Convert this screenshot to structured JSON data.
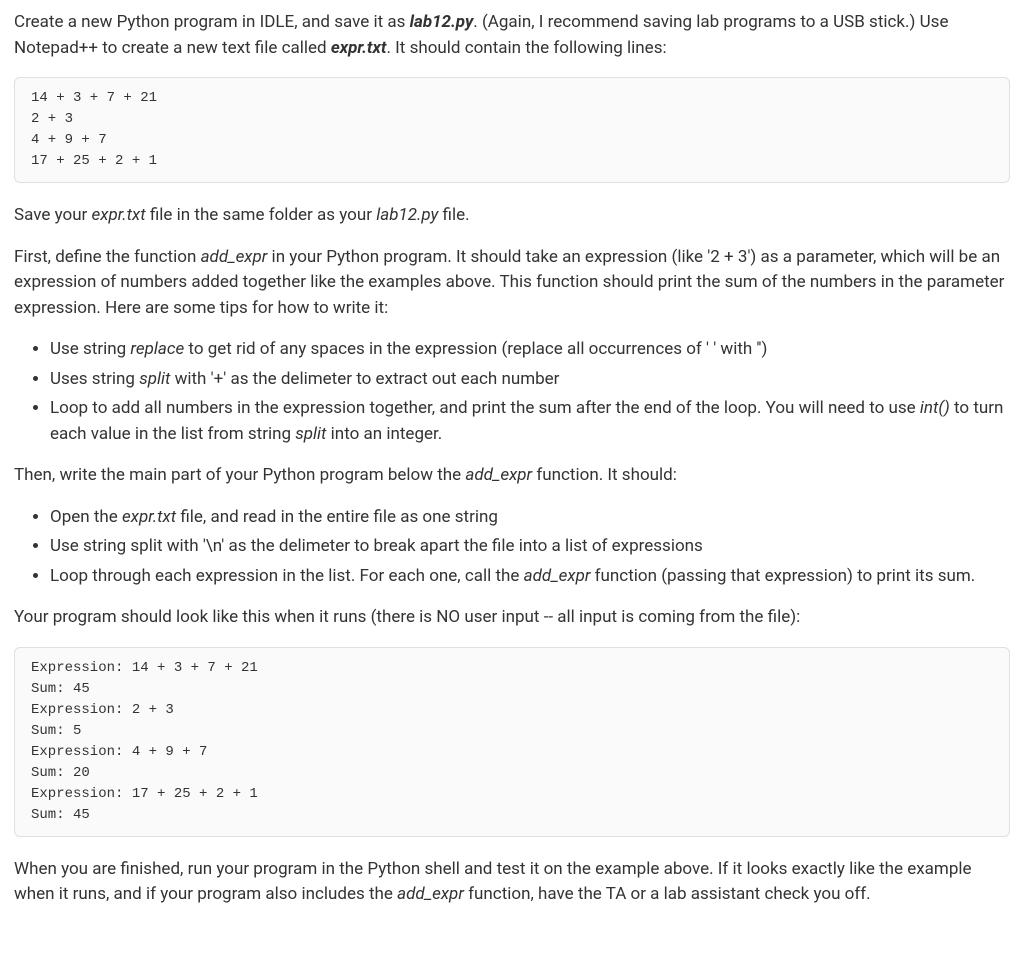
{
  "intro": {
    "part1": "Create a new Python program in IDLE, and save it as ",
    "lab12": "lab12.py",
    "part2": ". (Again, I recommend saving lab programs to a USB stick.) Use Notepad++ to create a new text file called ",
    "exprtxt": "expr.txt",
    "part3": ". It should contain the following lines:"
  },
  "code1": "14 + 3 + 7 + 21\n2 + 3\n4 + 9 + 7\n17 + 25 + 2 + 1",
  "savepara": {
    "part1": "Save your ",
    "exprfile": "expr.txt",
    "part2": " file in the same folder as your ",
    "lab12file": "lab12.py",
    "part3": " file."
  },
  "firstpara": {
    "part1": "First, define the function ",
    "addexpr": "add_expr",
    "part2": " in your Python program. It should take an expression (like '2 + 3') as a parameter, which will be an expression of numbers added together like the examples above. This function should print the sum of the numbers in the parameter expression. Here are some tips for how to write it:"
  },
  "list1": {
    "item1_a": "Use string ",
    "item1_replace": "replace",
    "item1_b": " to get rid of any spaces in the expression (replace all occurrences of ' ' with '')",
    "item2_a": "Uses string ",
    "item2_split": "split",
    "item2_b": " with '+' as the delimeter to extract out each number",
    "item3_a": "Loop to add all numbers in the expression together, and print the sum after the end of the loop. You will need to use ",
    "item3_int": "int()",
    "item3_b": " to turn each value in the list from string ",
    "item3_split": "split",
    "item3_c": " into an integer."
  },
  "thenpara": {
    "part1": "Then, write the main part of your Python program below the ",
    "addexpr": "add_expr",
    "part2": " function. It should:"
  },
  "list2": {
    "item1_a": "Open the ",
    "item1_expr": "expr.txt",
    "item1_b": " file, and read in the entire file as one string",
    "item2": "Use string split with '\\n' as the delimeter to break apart the file into a list of expressions",
    "item3_a": "Loop through each expression in the list. For each one, call the ",
    "item3_addexpr": "add_expr",
    "item3_b": " function (passing that expression) to print its sum."
  },
  "runpara": "Your program should look like this when it runs (there is NO user input -- all input is coming from the file):",
  "code2": "Expression: 14 + 3 + 7 + 21\nSum: 45\nExpression: 2 + 3\nSum: 5\nExpression: 4 + 9 + 7\nSum: 20\nExpression: 17 + 25 + 2 + 1\nSum: 45",
  "finalpara": {
    "part1": "When you are finished, run your program in the Python shell and test it on the example above. If it looks exactly like the example when it runs, and if your program also includes the ",
    "addexpr": "add_expr",
    "part2": " function, have the TA or a lab assistant check you off."
  }
}
